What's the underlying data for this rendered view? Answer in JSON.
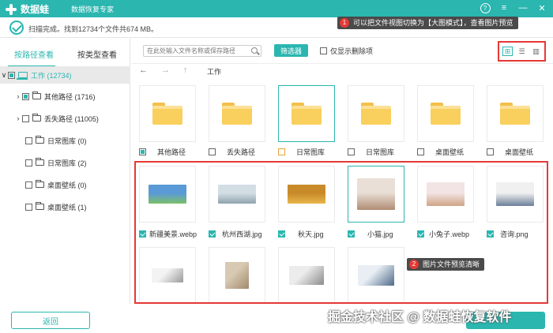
{
  "titlebar": {
    "app_name": "数据蛙",
    "subtitle": "数据恢复专家"
  },
  "status": {
    "text": "扫描完成。找到12734个文件共674 MB。"
  },
  "callouts": [
    {
      "num": "1",
      "text": "可以把文件视图切换为【大图模式】，查看图片预览"
    },
    {
      "num": "2",
      "text": "图片文件预览清晰"
    }
  ],
  "tabs": [
    {
      "label": "按路径查看"
    },
    {
      "label": "按类型查看"
    }
  ],
  "tree": [
    {
      "label": "工作 (12734)"
    },
    {
      "label": "其他路径 (1716)"
    },
    {
      "label": "丢失路径 (11005)"
    },
    {
      "label": "日常图库 (0)"
    },
    {
      "label": "日常图库 (2)"
    },
    {
      "label": "桌面壁纸 (0)"
    },
    {
      "label": "桌面壁纸 (1)"
    }
  ],
  "toolbar": {
    "search_placeholder": "在此处输入文件名称或保存路径",
    "filter_label": "筛选器",
    "only_deleted_label": "仅显示删除项"
  },
  "breadcrumb": "工作",
  "folders": [
    {
      "name": "其他路径",
      "checked": "partial"
    },
    {
      "name": "丢失路径",
      "checked": "none"
    },
    {
      "name": "日常图库",
      "checked": "none"
    },
    {
      "name": "日常图库",
      "checked": "none"
    },
    {
      "name": "桌面壁纸",
      "checked": "none"
    },
    {
      "name": "桌面壁纸",
      "checked": "none"
    }
  ],
  "images": [
    {
      "name": "新疆美景.webp",
      "checked": true,
      "color1": "#5a9ad6",
      "color2": "#7cbf6a"
    },
    {
      "name": "杭州西湖.jpg",
      "checked": true,
      "color1": "#d3dde4",
      "color2": "#8fa3ad"
    },
    {
      "name": "秋天.jpg",
      "checked": true,
      "color1": "#c98a2a",
      "color2": "#e7b64a"
    },
    {
      "name": "小猫.jpg",
      "checked": true,
      "color1": "#e9dfd6",
      "color2": "#b08c74"
    },
    {
      "name": "小兔子.webp",
      "checked": true,
      "color1": "#f2e4e4",
      "color2": "#cfa486"
    },
    {
      "name": "咨询.png",
      "checked": true,
      "color1": "#f0f0f0",
      "color2": "#6b7f99"
    }
  ],
  "images_row2": [
    {
      "color1": "#f3f3f3",
      "color2": "#9a9a9a"
    },
    {
      "color1": "#d8c9b2",
      "color2": "#a08a6c"
    },
    {
      "color1": "#ececec",
      "color2": "#8b8b8b"
    },
    {
      "color1": "#e8eef4",
      "color2": "#4f6a8a"
    }
  ],
  "back_label": "返回",
  "watermark": "掘金技术社区 @ 数据蛙恢复软件",
  "colors": {
    "accent": "#2bb6b0",
    "highlight": "#e53935"
  }
}
